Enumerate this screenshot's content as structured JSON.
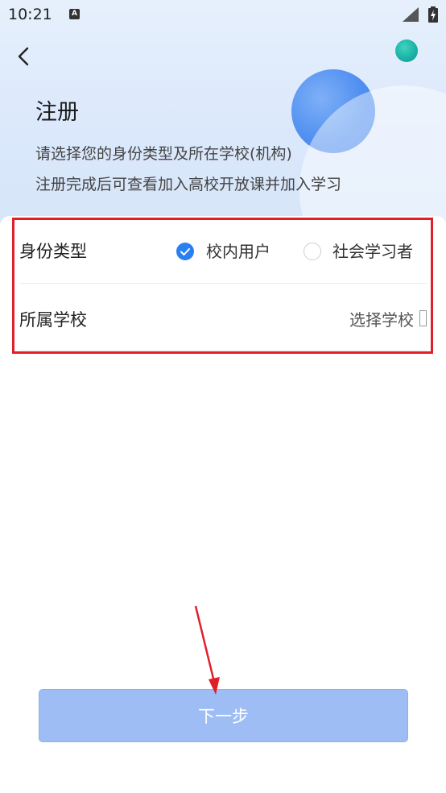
{
  "status_bar": {
    "time": "10:21",
    "notification_icon": "A"
  },
  "header": {
    "title": "注册",
    "subtitle_line1": "请选择您的身份类型及所在学校(机构)",
    "subtitle_line2": "注册完成后可查看加入高校开放课并加入学习"
  },
  "form": {
    "identity": {
      "label": "身份类型",
      "options": [
        {
          "label": "校内用户",
          "selected": true
        },
        {
          "label": "社会学习者",
          "selected": false
        }
      ]
    },
    "school": {
      "label": "所属学校",
      "placeholder": "选择学校"
    }
  },
  "next_button": {
    "label": "下一步"
  },
  "colors": {
    "accent": "#2a7ff3",
    "button": "#9dbdf4",
    "highlight": "#e11f2b"
  },
  "icons": [
    "back-arrow-icon",
    "check-icon",
    "chevron-right-icon",
    "signal-icon",
    "battery-icon"
  ]
}
